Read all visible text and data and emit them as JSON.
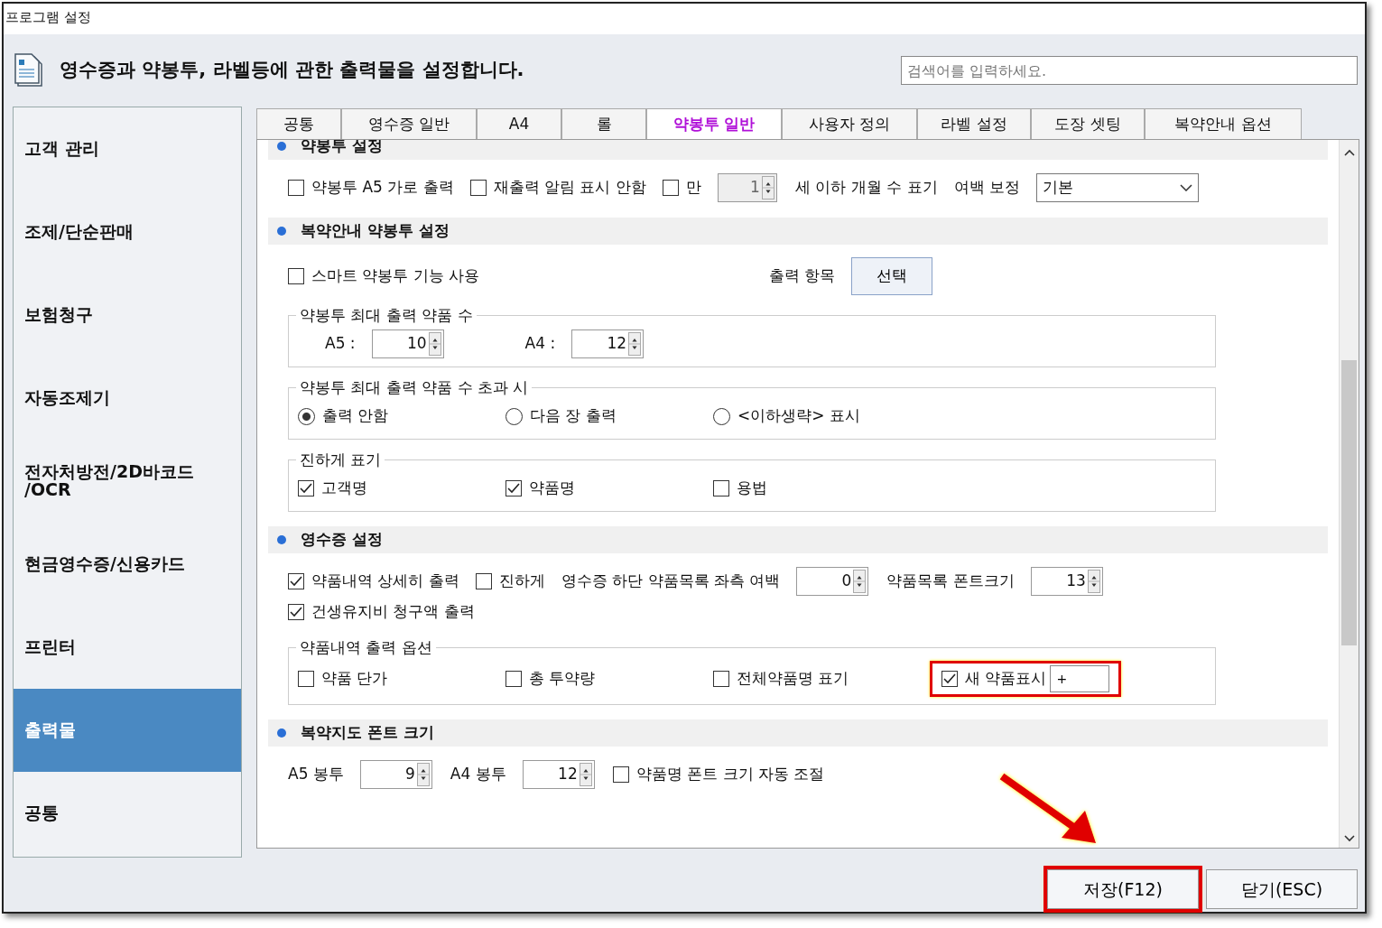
{
  "window": {
    "title": "프로그램 설정"
  },
  "header": {
    "text": "영수증과 약봉투, 라벨등에 관한 출력물을 설정합니다.",
    "search": {
      "placeholder": "검색어를 입력하세요."
    }
  },
  "sidebar": {
    "items": [
      {
        "label": "고객 관리",
        "selected": false
      },
      {
        "label": "조제/단순판매",
        "selected": false
      },
      {
        "label": "보험청구",
        "selected": false
      },
      {
        "label": "자동조제기",
        "selected": false
      },
      {
        "label": "전자처방전/2D바코드\n/OCR",
        "selected": false
      },
      {
        "label": "현금영수증/신용카드",
        "selected": false
      },
      {
        "label": "프린터",
        "selected": false
      },
      {
        "label": "출력물",
        "selected": true
      },
      {
        "label": "공통",
        "selected": false
      }
    ]
  },
  "tabs": [
    {
      "label": "공통",
      "selected": false
    },
    {
      "label": "영수증 일반",
      "selected": false
    },
    {
      "label": "A4",
      "selected": false
    },
    {
      "label": "롤",
      "selected": false
    },
    {
      "label": "약봉투 일반",
      "selected": true
    },
    {
      "label": "사용자 정의",
      "selected": false
    },
    {
      "label": "라벨 설정",
      "selected": false
    },
    {
      "label": "도장 셋팅",
      "selected": false
    },
    {
      "label": "복약안내 옵션",
      "selected": false
    }
  ],
  "sections": [
    {
      "kind": "section",
      "title": "약봉투 설정",
      "rows": [
        [
          {
            "kind": "checkbox",
            "label": "약봉투 A5 가로 출력",
            "checked": false
          },
          {
            "kind": "checkbox",
            "label": "재출력 알림 표시 안함",
            "checked": false
          },
          {
            "kind": "checkbox",
            "label": "만",
            "checked": false
          },
          {
            "kind": "spin",
            "value": "1",
            "disabled": true
          },
          {
            "kind": "text",
            "text": "세 이하 개월 수 표기"
          },
          {
            "kind": "text",
            "text": "여백 보정"
          },
          {
            "kind": "select",
            "value": "기본"
          }
        ]
      ]
    },
    {
      "kind": "section",
      "title": "복약안내 약봉투 설정",
      "rows": [
        [
          {
            "kind": "checkbox",
            "label": "스마트 약봉투 기능 사용",
            "checked": false
          },
          {
            "kind": "text",
            "text": "출력 항목"
          },
          {
            "kind": "button",
            "label": "선택"
          }
        ]
      ]
    },
    {
      "kind": "group",
      "title": "약봉투 최대 출력 약품 수",
      "rows": [
        [
          {
            "kind": "text",
            "text": "A5 :"
          },
          {
            "kind": "spin",
            "value": "10",
            "disabled": false
          },
          {
            "kind": "text",
            "text": "A4 :"
          },
          {
            "kind": "spin",
            "value": "12",
            "disabled": false
          }
        ]
      ]
    },
    {
      "kind": "group",
      "title": "약봉투 최대 출력 약품 수 초과 시",
      "rows": [
        [
          {
            "kind": "radio",
            "label": "출력 안함",
            "selected": true
          },
          {
            "kind": "radio",
            "label": "다음 장 출력",
            "selected": false
          },
          {
            "kind": "radio",
            "label": "<이하생략> 표시",
            "selected": false
          }
        ]
      ]
    },
    {
      "kind": "group",
      "title": "진하게 표기",
      "rows": [
        [
          {
            "kind": "checkbox",
            "label": "고객명",
            "checked": true
          },
          {
            "kind": "checkbox",
            "label": "약품명",
            "checked": true
          },
          {
            "kind": "checkbox",
            "label": "용법",
            "checked": false
          }
        ]
      ]
    },
    {
      "kind": "section",
      "title": "영수증 설정",
      "rows": [
        [
          {
            "kind": "checkbox",
            "label": "약품내역 상세히 출력",
            "checked": true
          },
          {
            "kind": "checkbox",
            "label": "진하게",
            "checked": false
          },
          {
            "kind": "text",
            "text": "영수증 하단 약품목록 좌측 여백"
          },
          {
            "kind": "spin",
            "value": "0",
            "disabled": false
          },
          {
            "kind": "text",
            "text": "약품목록 폰트크기"
          },
          {
            "kind": "spin",
            "value": "13",
            "disabled": false
          }
        ],
        [
          {
            "kind": "checkbox",
            "label": "건생유지비 청구액 출력",
            "checked": true
          }
        ]
      ]
    },
    {
      "kind": "group",
      "title": "약품내역 출력 옵션",
      "rows": [
        [
          {
            "kind": "checkbox",
            "label": "약품 단가",
            "checked": false
          },
          {
            "kind": "checkbox",
            "label": "총 투약량",
            "checked": false
          },
          {
            "kind": "checkbox",
            "label": "전체약품명 표기",
            "checked": false
          },
          {
            "kind": "highlight",
            "highlighted": true,
            "items": [
              {
                "kind": "checkbox",
                "label": "새 약품표시",
                "checked": true
              },
              {
                "kind": "input",
                "value": "+"
              }
            ]
          }
        ]
      ]
    },
    {
      "kind": "section",
      "title": "복약지도 폰트 크기",
      "rows": [
        [
          {
            "kind": "text",
            "text": "A5 봉투"
          },
          {
            "kind": "spin",
            "value": "9",
            "disabled": false
          },
          {
            "kind": "text",
            "text": "A4 봉투"
          },
          {
            "kind": "spin",
            "value": "12",
            "disabled": false
          },
          {
            "kind": "checkbox",
            "label": "약품명 폰트 크기 자동 조절",
            "checked": false
          }
        ]
      ]
    }
  ],
  "annotation_arrow": true,
  "footer": {
    "buttons": [
      {
        "label": "저장(F12)",
        "highlighted": true
      },
      {
        "label": "닫기(ESC)",
        "highlighted": false
      }
    ]
  }
}
